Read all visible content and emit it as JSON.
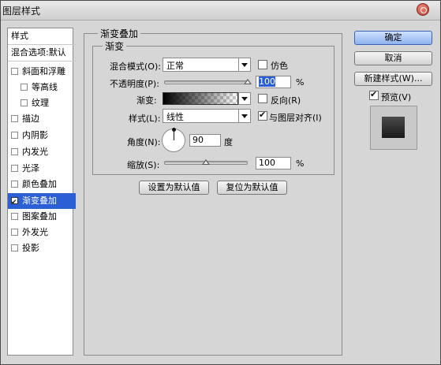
{
  "window": {
    "title": "图层样式"
  },
  "sidebar": {
    "header": "样式",
    "blend_defaults": "混合选项:默认",
    "items": [
      {
        "label": "斜面和浮雕",
        "checked": false
      },
      {
        "label": "等高线",
        "checked": false
      },
      {
        "label": "纹理",
        "checked": false
      },
      {
        "label": "描边",
        "checked": false
      },
      {
        "label": "内阴影",
        "checked": false
      },
      {
        "label": "内发光",
        "checked": false
      },
      {
        "label": "光泽",
        "checked": false
      },
      {
        "label": "颜色叠加",
        "checked": false
      },
      {
        "label": "渐变叠加",
        "checked": true
      },
      {
        "label": "图案叠加",
        "checked": false
      },
      {
        "label": "外发光",
        "checked": false
      },
      {
        "label": "投影",
        "checked": false
      }
    ]
  },
  "panel": {
    "title": "渐变叠加",
    "subgroup": "渐变",
    "blend_mode_label": "混合模式(O):",
    "blend_mode_value": "正常",
    "dither_label": "仿色",
    "opacity_label": "不透明度(P):",
    "opacity_value": "100",
    "opacity_fraction": 1.0,
    "gradient_label": "渐变:",
    "reverse_label": "反向(R)",
    "style_label": "样式(L):",
    "style_value": "线性",
    "align_label": "与图层对齐(I)",
    "angle_label": "角度(N):",
    "angle_value": "90",
    "angle_unit": "度",
    "scale_label": "缩放(S):",
    "scale_value": "100",
    "scale_fraction": 0.5,
    "percent": "%",
    "make_default": "设置为默认值",
    "reset_default": "复位为默认值"
  },
  "buttons": {
    "ok": "确定",
    "cancel": "取消",
    "new_style": "新建样式(W)...",
    "preview": "预览(V)"
  },
  "colors": {
    "accent": "#2a5fd6"
  }
}
